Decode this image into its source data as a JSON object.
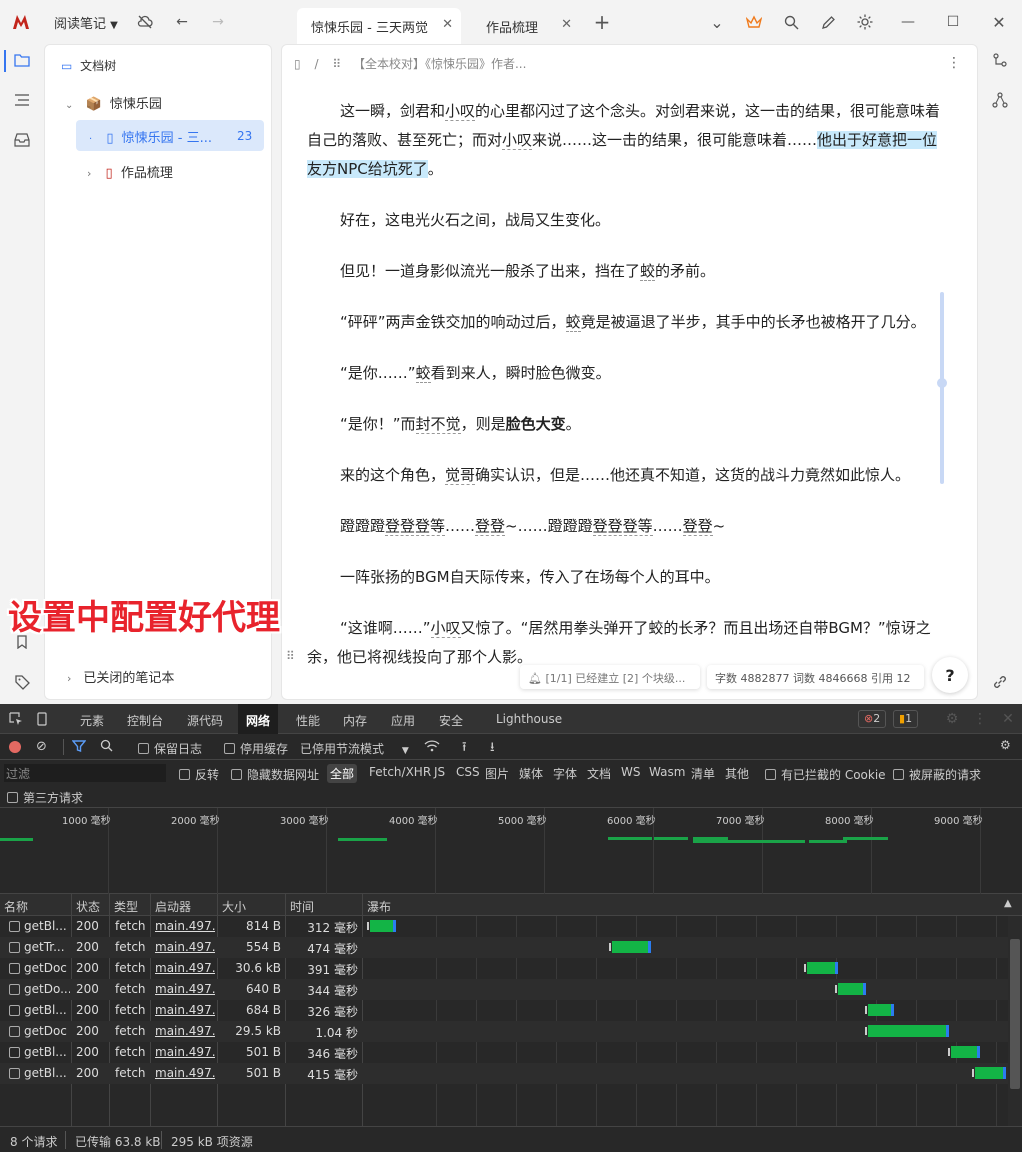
{
  "titlebar": {
    "notebook": "阅读笔记",
    "tabs": [
      {
        "label": "惊悚乐园 - 三天两觉",
        "active": true
      },
      {
        "label": "作品梳理",
        "active": false
      }
    ],
    "new_tab": "+",
    "chevron": "⌄",
    "minimize": "—",
    "maximize": "☐",
    "close": "✕"
  },
  "sidebar": {
    "title": "文档树",
    "root": "惊悚乐园",
    "child_selected": "惊悚乐园 - 三...",
    "child_count": "23",
    "child2": "作品梳理",
    "closed": "已关闭的笔记本"
  },
  "editor": {
    "breadcrumb": "【全本校对】《惊悚乐园》作者...",
    "p1a": "这一瞬，剑君和",
    "p1b": "小叹",
    "p1c": "的心里都闪过了这个念头。对剑君来说，这一击的结果，很可能意味着自己的落败、甚至死亡；而对",
    "p1d": "小叹",
    "p1e": "来说……这一击的结果，很可能意味着……",
    "p1hl": "他出于好意把一位友方NPC给坑死了",
    "p1f": "。",
    "p2": "好在，这电光火石之间，战局又生变化。",
    "p3a": "但见！一道身影似流光一般杀了出来，挡在了",
    "p3b": "蛟",
    "p3c": "的矛前。",
    "p4a": "“砰砰”两声金铁交加的响动过后，",
    "p4b": "蛟",
    "p4c": "竟是被逼退了半步，其手中的长矛也被格开了几分。",
    "p5a": "“是你……”",
    "p5b": "蛟",
    "p5c": "看到来人，瞬时脸色微变。",
    "p6a": "“是你！”而",
    "p6b": "封不觉",
    "p6c": "，则是",
    "p6d": "脸色大变",
    "p6e": "。",
    "p7a": "来的这个角色，",
    "p7b": "觉哥",
    "p7c": "确实认识，但是……他还真不知道，这货的战斗力竟然如此惊人。",
    "p8a": "蹬蹬蹬",
    "p8b": "登登登等",
    "p8c": "……",
    "p8d": "登登",
    "p8e": "~……",
    "p8f": "蹬蹬蹬",
    "p8g": "登登登等",
    "p8h": "……",
    "p8i": "登登",
    "p8j": "~",
    "p9": "一阵张扬的BGM自天际传来，传入了在场每个人的耳中。",
    "p10a": "“这谁啊……”",
    "p10b": "小叹",
    "p10c": "又惊了。“居然用拳头弹开了蛟的长矛？而且出场还自带BGM？”惊讶之余，他已将视线投向了那个人影。",
    "status_sync": "[1/1] 已经建立 [2] 个块级...",
    "status_count": "字数 4882877  词数 4846668  引用 12",
    "help": "?"
  },
  "overlay_text": "设置中配置好代理",
  "devtools": {
    "tabs": [
      "元素",
      "控制台",
      "源代码",
      "网络",
      "性能",
      "内存",
      "应用",
      "安全",
      "Lighthouse"
    ],
    "active_tab": "网络",
    "errors": "2",
    "warnings": "1",
    "row2": {
      "preserve_log": "保留日志",
      "disable_cache": "停用缓存",
      "throttle": "已停用节流模式"
    },
    "row3": {
      "filter_placeholder": "过滤",
      "invert": "反转",
      "hide_data_urls": "隐藏数据网址",
      "types": [
        "全部",
        "Fetch/XHR",
        "JS",
        "CSS",
        "图片",
        "媒体",
        "字体",
        "文档",
        "WS",
        "Wasm",
        "清单",
        "其他"
      ],
      "blocked_cookies": "有已拦截的 Cookie",
      "blocked_requests": "被屏蔽的请求"
    },
    "third_party": "第三方请求",
    "ticks": [
      "1000 毫秒",
      "2000 毫秒",
      "3000 毫秒",
      "4000 毫秒",
      "5000 毫秒",
      "6000 毫秒",
      "7000 毫秒",
      "8000 毫秒",
      "9000 毫秒"
    ],
    "columns": [
      "名称",
      "状态",
      "类型",
      "启动器",
      "大小",
      "时间",
      "瀑布"
    ],
    "rows": [
      {
        "name": "getBl...",
        "status": "200",
        "type": "fetch",
        "initiator": "main.497...",
        "size": "814 B",
        "time": "312 毫秒"
      },
      {
        "name": "getTr...",
        "status": "200",
        "type": "fetch",
        "initiator": "main.497...",
        "size": "554 B",
        "time": "474 毫秒"
      },
      {
        "name": "getDoc",
        "status": "200",
        "type": "fetch",
        "initiator": "main.497...",
        "size": "30.6 kB",
        "time": "391 毫秒"
      },
      {
        "name": "getDo...",
        "status": "200",
        "type": "fetch",
        "initiator": "main.497...",
        "size": "640 B",
        "time": "344 毫秒"
      },
      {
        "name": "getBl...",
        "status": "200",
        "type": "fetch",
        "initiator": "main.497...",
        "size": "684 B",
        "time": "326 毫秒"
      },
      {
        "name": "getDoc",
        "status": "200",
        "type": "fetch",
        "initiator": "main.497...",
        "size": "29.5 kB",
        "time": "1.04 秒"
      },
      {
        "name": "getBl...",
        "status": "200",
        "type": "fetch",
        "initiator": "main.497...",
        "size": "501 B",
        "time": "346 毫秒"
      },
      {
        "name": "getBl...",
        "status": "200",
        "type": "fetch",
        "initiator": "main.497...",
        "size": "501 B",
        "time": "415 毫秒"
      }
    ],
    "footer": {
      "requests": "8 个请求",
      "transferred": "已传输 63.8 kB",
      "resources": "295 kB 项资源"
    },
    "colors": {
      "bar": "#13b446",
      "accent": "#2b7df0"
    }
  }
}
